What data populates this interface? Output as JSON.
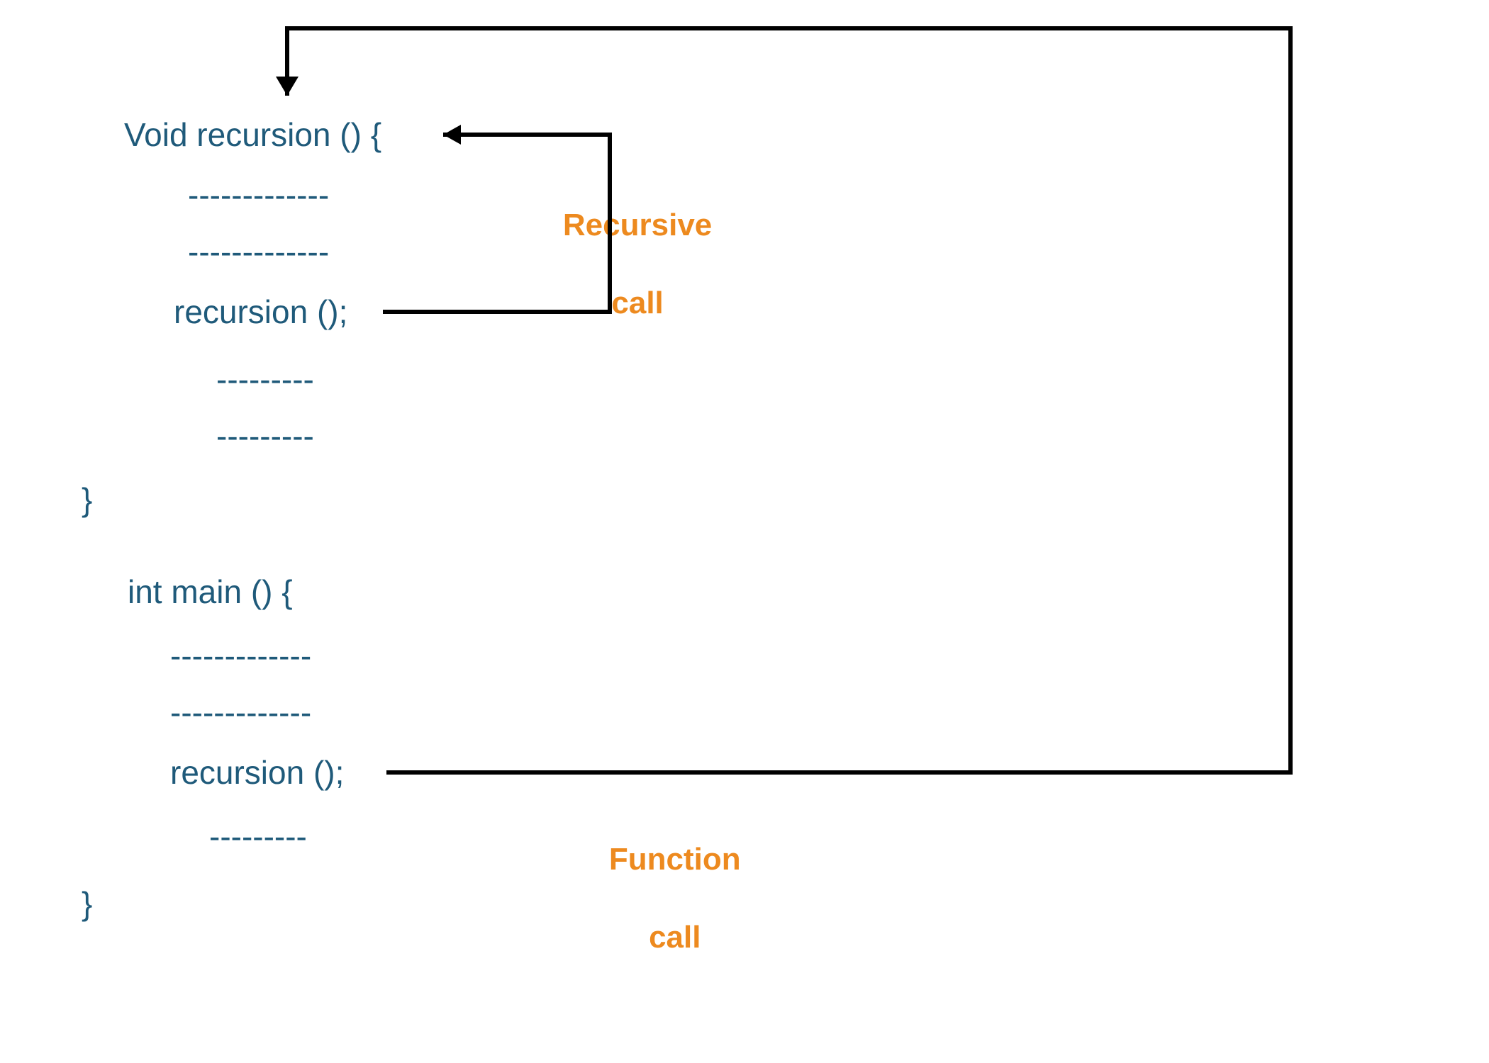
{
  "colors": {
    "code": "#1f5a7a",
    "label": "#ed8a1f",
    "arrow": "#000000"
  },
  "code": {
    "fn_decl": "Void recursion () {",
    "dash_long_1": "-------------",
    "dash_long_2": "-------------",
    "recursion_call_1": "recursion ();",
    "dash_short_1": "---------",
    "dash_short_2": "---------",
    "close_brace_1": "}",
    "main_decl": "int main () {",
    "dash_long_3": "-------------",
    "dash_long_4": "-------------",
    "recursion_call_2": "recursion ();",
    "dash_short_3": "---------",
    "close_brace_2": "}"
  },
  "labels": {
    "recursive_line1": "Recursive",
    "recursive_line2": "call",
    "function_line1": "Function",
    "function_line2": "call"
  },
  "diagram": {
    "description": "Recursion concept diagram: main() calls recursion(); recursion() recursively calls itself.",
    "arrows": [
      {
        "name": "recursive-call-arrow",
        "from": "recursion() call inside Void recursion()",
        "to": "Void recursion () { header",
        "label": "Recursive call"
      },
      {
        "name": "function-call-arrow",
        "from": "recursion() call inside int main()",
        "to": "Void recursion () { header",
        "label": "Function call"
      }
    ]
  }
}
